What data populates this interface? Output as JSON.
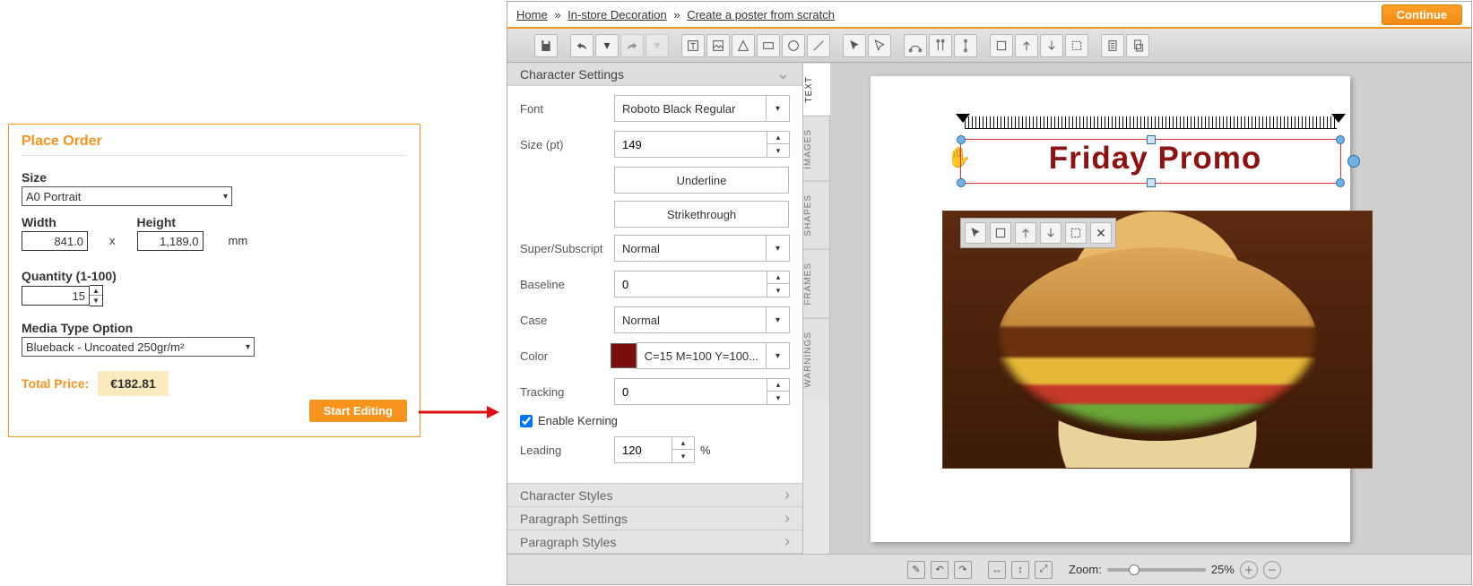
{
  "order": {
    "title": "Place Order",
    "size_label": "Size",
    "size_value": "A0 Portrait",
    "width_label": "Width",
    "width_value": "841.0",
    "dim_sep": "x",
    "height_label": "Height",
    "height_value": "1,189.0",
    "unit": "mm",
    "qty_label": "Quantity (1-100)",
    "qty_value": "15",
    "media_label": "Media Type Option",
    "media_value": "Blueback - Uncoated 250gr/m²",
    "total_label": "Total Price:",
    "total_value": "€182.81",
    "start_btn": "Start Editing"
  },
  "breadcrumb": {
    "home": "Home",
    "l2": "In-store Decoration",
    "l3": "Create a poster from scratch",
    "continue": "Continue"
  },
  "character": {
    "title": "Character Settings",
    "font_label": "Font",
    "font_value": "Roboto Black Regular",
    "size_label": "Size (pt)",
    "size_value": "149",
    "underline": "Underline",
    "strike": "Strikethrough",
    "supersub_label": "Super/Subscript",
    "supersub_value": "Normal",
    "baseline_label": "Baseline",
    "baseline_value": "0",
    "case_label": "Case",
    "case_value": "Normal",
    "color_label": "Color",
    "color_value": "C=15 M=100 Y=100...",
    "color_hex": "#7a0d0d",
    "tracking_label": "Tracking",
    "tracking_value": "0",
    "kerning_label": "Enable Kerning",
    "leading_label": "Leading",
    "leading_value": "120",
    "leading_unit": "%"
  },
  "accordions": {
    "char_styles": "Character Styles",
    "para_settings": "Paragraph Settings",
    "para_styles": "Paragraph Styles"
  },
  "tabs": {
    "text": "TEXT",
    "images": "IMAGES",
    "shapes": "SHAPES",
    "frames": "FRAMES",
    "warnings": "WARNINGS"
  },
  "canvas": {
    "headline": "Friday Promo"
  },
  "status": {
    "zoom_label": "Zoom:",
    "zoom_value": "25%"
  }
}
